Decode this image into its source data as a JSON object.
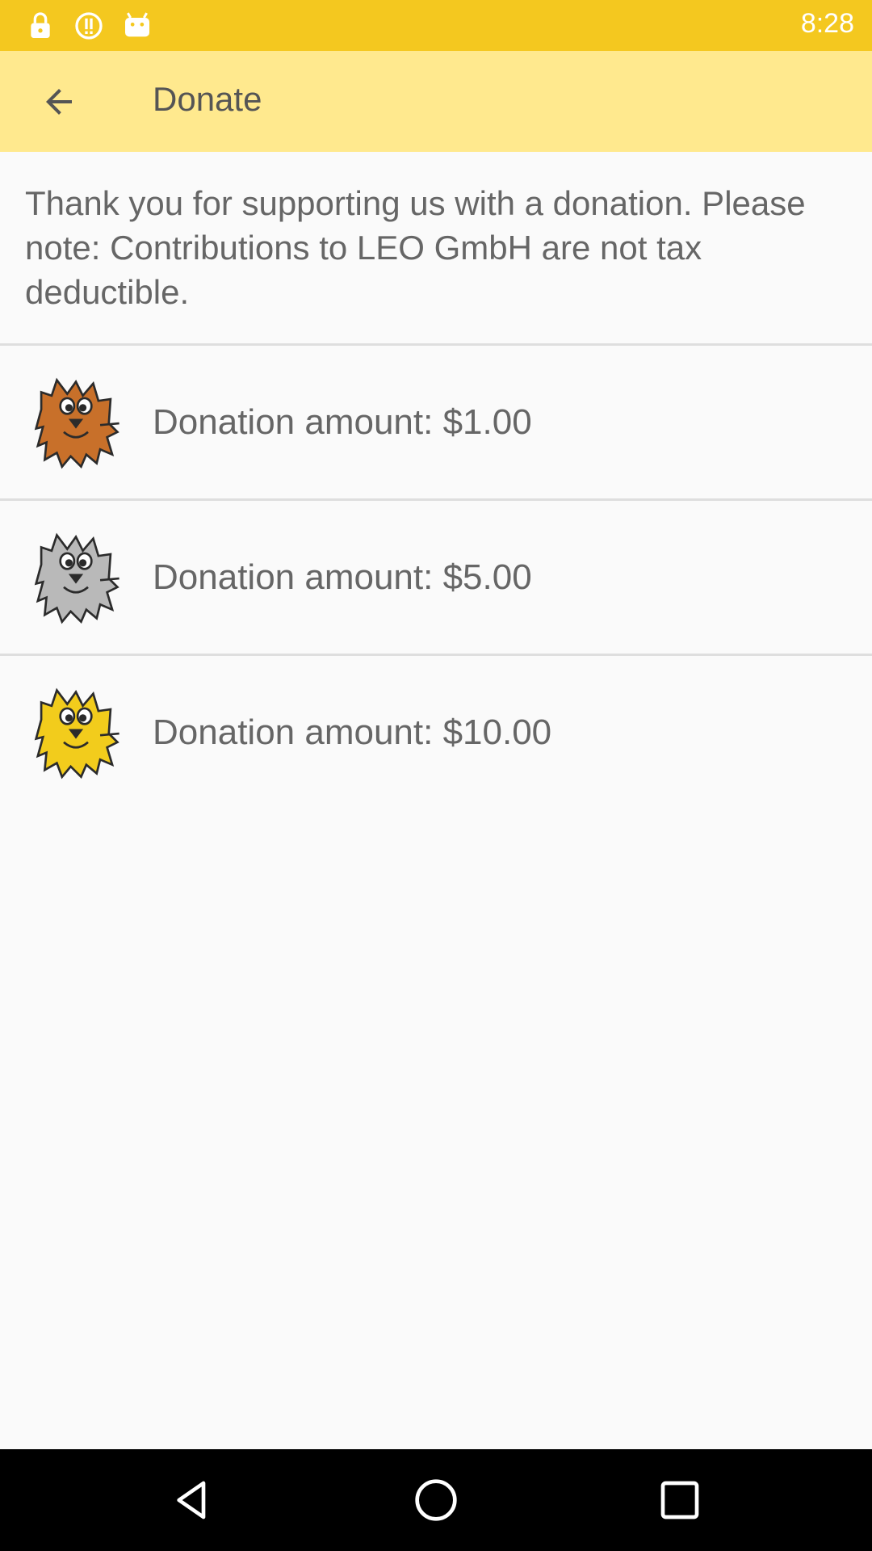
{
  "status_bar": {
    "time": "8:28",
    "icons": [
      "lock-icon",
      "alert-icon",
      "android-icon"
    ],
    "color": "#f4c81f"
  },
  "app_bar": {
    "title": "Donate",
    "back_icon": "arrow-back-icon",
    "color": "#ffe98e"
  },
  "intro_text": "Thank you for supporting us with a donation. Please note: Contributions to LEO GmbH are not tax deductible.",
  "donations": [
    {
      "label": "Donation amount: $1.00",
      "icon": "leo-bronze-icon",
      "color": "#c8702a"
    },
    {
      "label": "Donation amount: $5.00",
      "icon": "leo-silver-icon",
      "color": "#b9b9b9"
    },
    {
      "label": "Donation amount: $10.00",
      "icon": "leo-gold-icon",
      "color": "#f2cc1c"
    }
  ],
  "nav_bar": {
    "buttons": [
      "back-triangle-icon",
      "home-circle-icon",
      "recents-square-icon"
    ]
  }
}
